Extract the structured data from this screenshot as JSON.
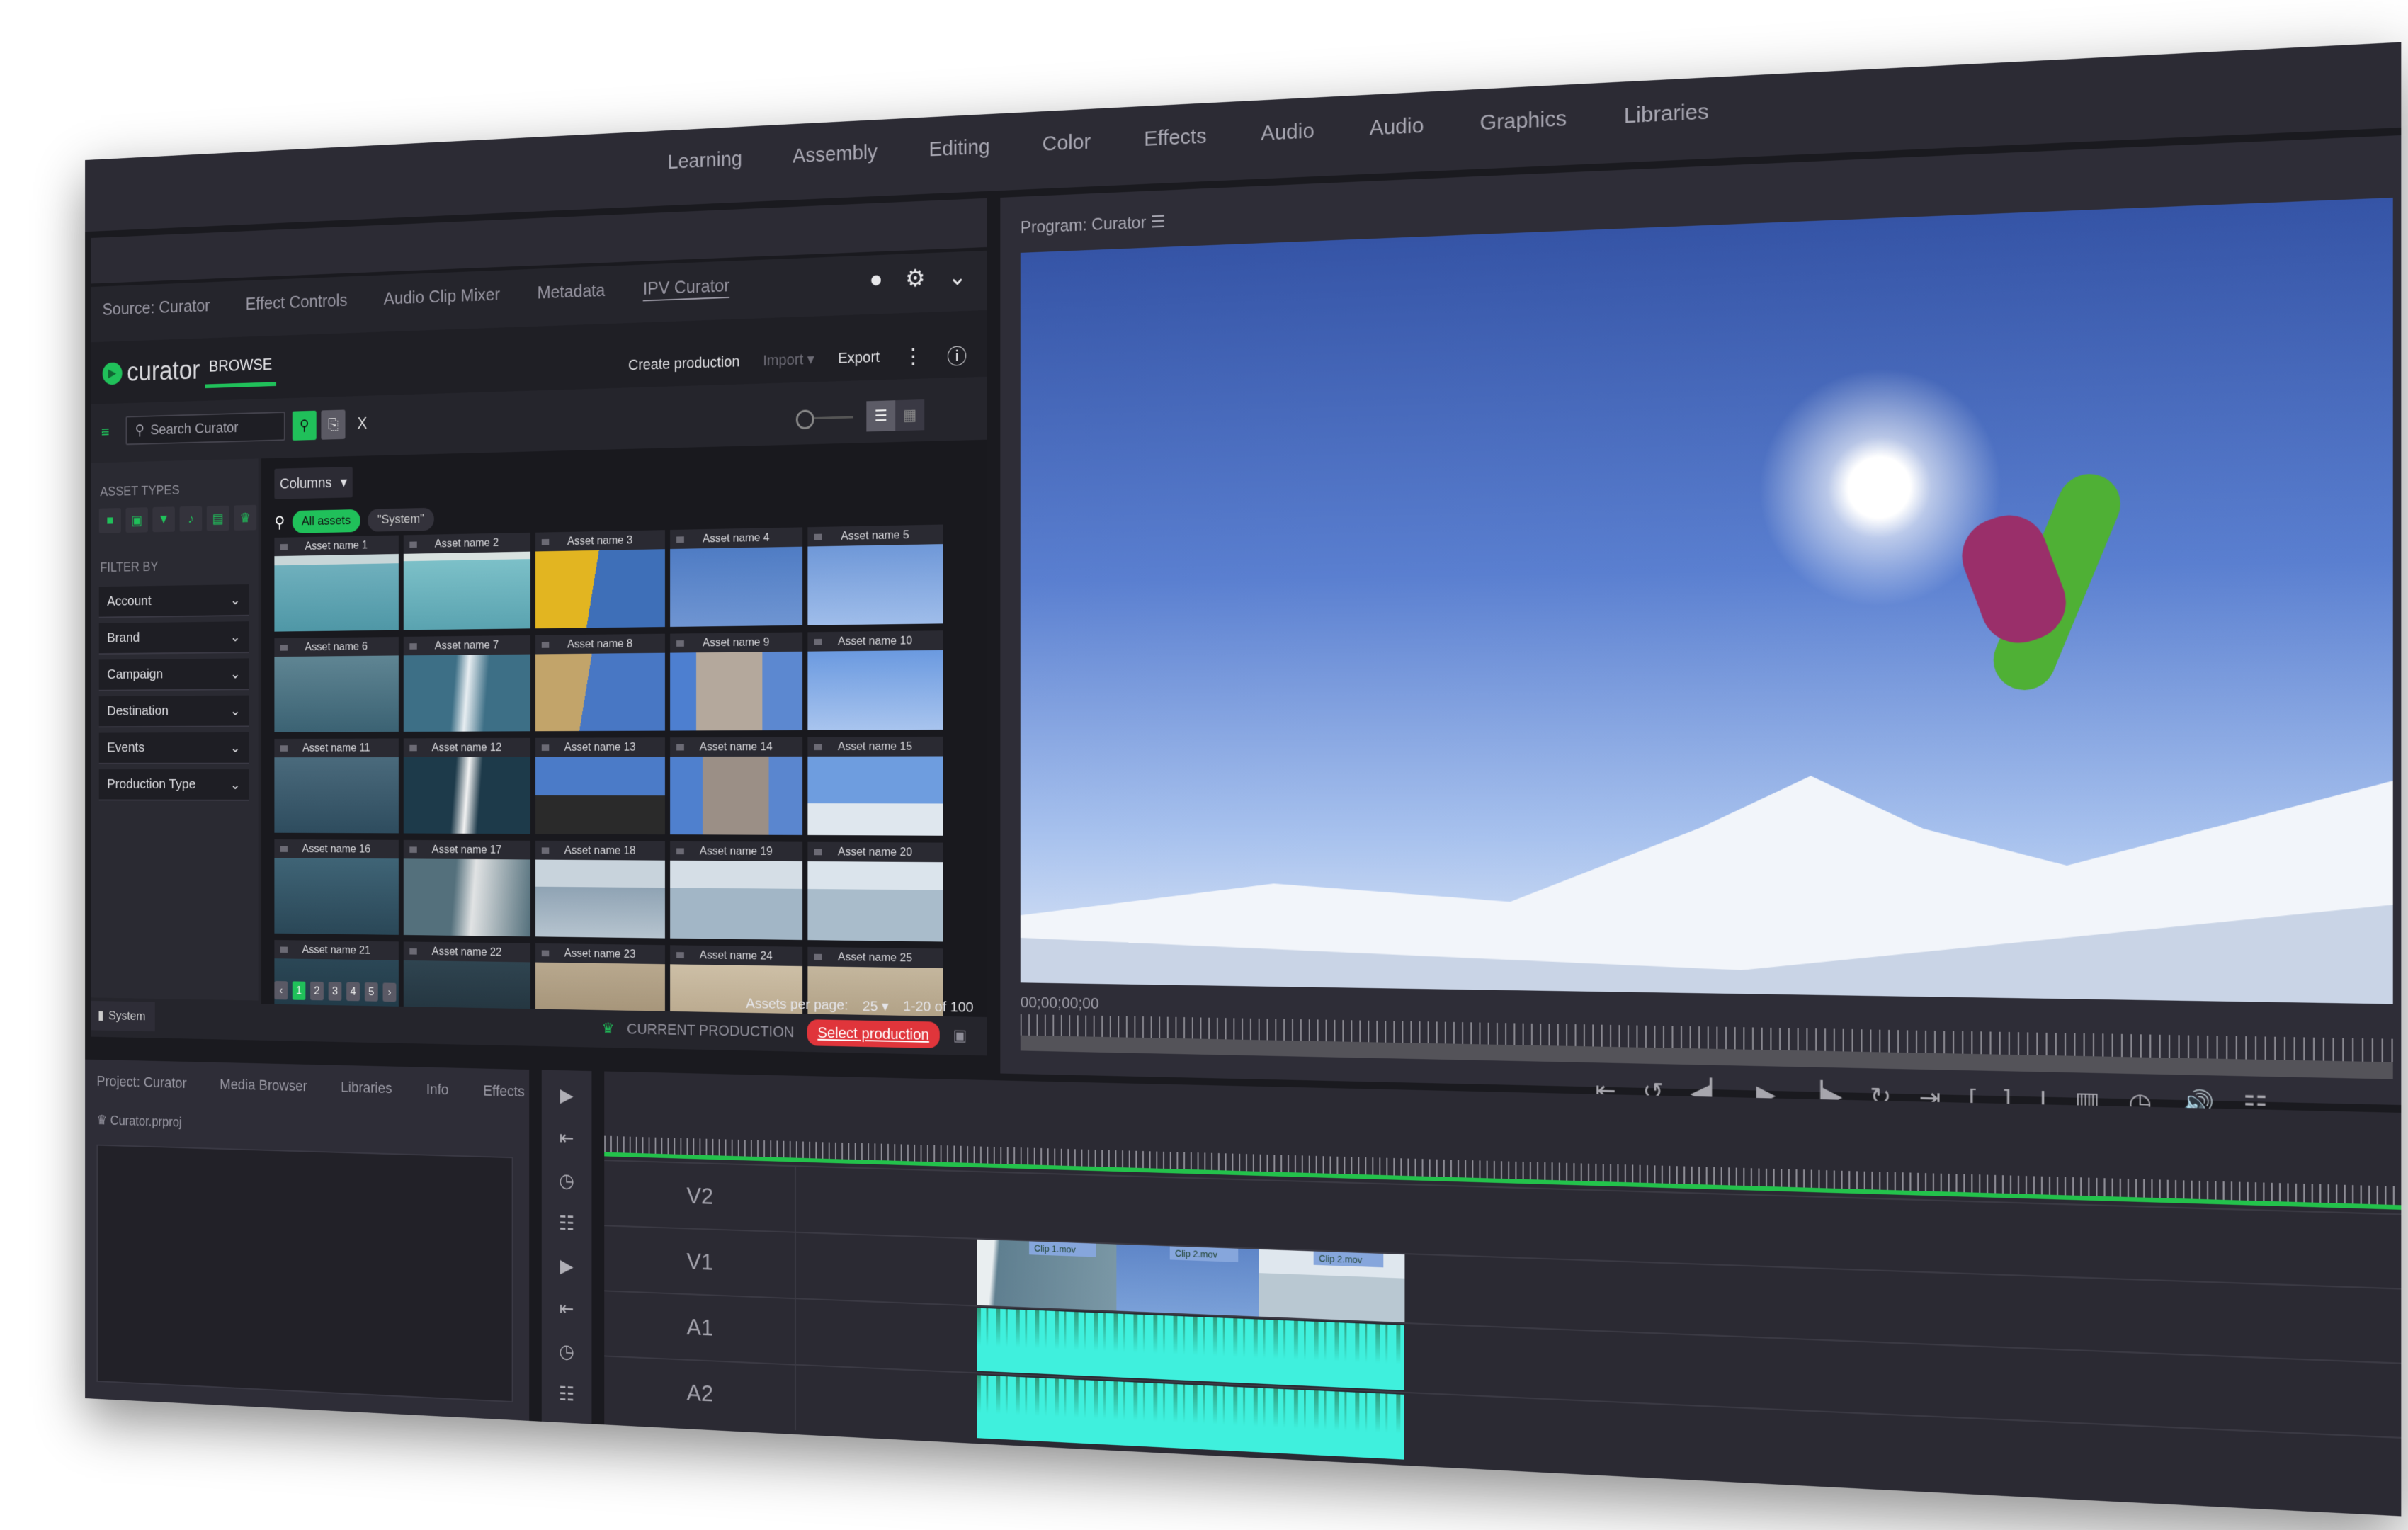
{
  "workspace_tabs": [
    "Learning",
    "Assembly",
    "Editing",
    "Color",
    "Effects",
    "Audio",
    "Audio",
    "Graphics",
    "Libraries"
  ],
  "source_panel": {
    "tabs": [
      "Source: Curator",
      "Effect Controls",
      "Audio Clip Mixer",
      "Metadata",
      "IPV Curator"
    ],
    "active_tab": "IPV Curator"
  },
  "curator": {
    "logo": "curator",
    "browse_tab": "BROWSE",
    "actions": {
      "create": "Create production",
      "import": "Import",
      "export": "Export"
    },
    "search": {
      "placeholder": "Search Curator",
      "clear": "X"
    },
    "sidebar": {
      "asset_types_label": "ASSET TYPES",
      "filter_by_label": "FILTER BY",
      "filters": [
        "Account",
        "Brand",
        "Campaign",
        "Destination",
        "Events",
        "Production Type"
      ]
    },
    "columns_label": "Columns",
    "chips": [
      "All assets",
      "\"System\""
    ],
    "assets": [
      "Asset name 1",
      "Asset name 2",
      "Asset name 3",
      "Asset name 4",
      "Asset name 5",
      "Asset name 6",
      "Asset name 7",
      "Asset name 8",
      "Asset name 9",
      "Asset name 10",
      "Asset name 11",
      "Asset name 12",
      "Asset name 13",
      "Asset name 14",
      "Asset name 15",
      "Asset name 16",
      "Asset name 17",
      "Asset name 18",
      "Asset name 19",
      "Asset name 20",
      "Asset name 21",
      "Asset name 22",
      "Asset name 23",
      "Asset name 24",
      "Asset name 25"
    ],
    "pager": {
      "prev": "‹",
      "pages": [
        "1",
        "2",
        "3",
        "4",
        "5"
      ],
      "current": "1",
      "next": "›"
    },
    "per_page_label": "Assets per page:",
    "per_page": "25",
    "range": "1-20 of 100",
    "system_tab": "System",
    "current_production_label": "CURRENT PRODUCTION",
    "select_production": "Select production"
  },
  "program": {
    "title": "Program: Curator",
    "timecode": "00;00;00;00"
  },
  "project": {
    "tabs": [
      "Project: Curator",
      "Media Browser",
      "Libraries",
      "Info",
      "Effects"
    ],
    "file": "Curator.prproj"
  },
  "timeline": {
    "tracks": [
      "V2",
      "V1",
      "A1",
      "A2"
    ],
    "clips": [
      "Clip 1.mov",
      "Clip 2.mov",
      "Clip 2.mov"
    ]
  },
  "colors": {
    "accent": "#20c05a",
    "danger": "#e0353b",
    "audio": "#3ff0dd",
    "playhead": "#23c24b"
  }
}
